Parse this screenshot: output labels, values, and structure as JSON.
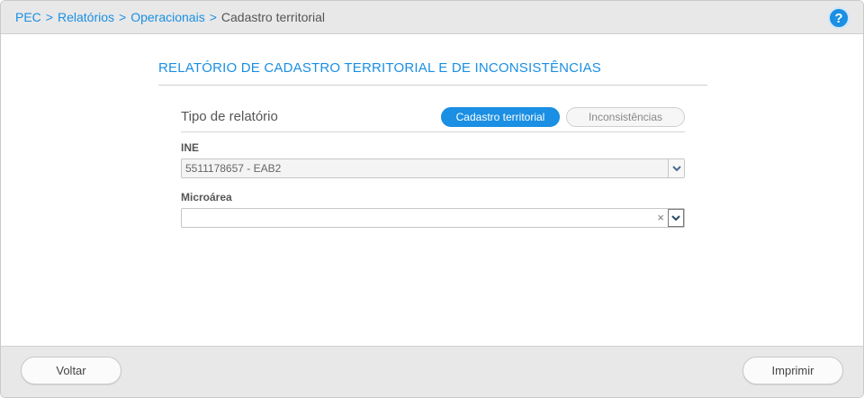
{
  "breadcrumb": {
    "items": [
      "PEC",
      "Relatórios",
      "Operacionais"
    ],
    "separator": ">",
    "current": "Cadastro territorial"
  },
  "help": {
    "label": "?",
    "icon": "help-circle-icon"
  },
  "report": {
    "title": "RELATÓRIO DE CADASTRO TERRITORIAL E DE INCONSISTÊNCIAS"
  },
  "form": {
    "type_label": "Tipo de relatório",
    "type_options": [
      "Cadastro territorial",
      "Inconsistências"
    ],
    "type_selected": "Cadastro territorial",
    "ine_label": "INE",
    "ine_value": "5511178657 - EAB2",
    "microarea_label": "Microárea",
    "microarea_value": "",
    "clear_symbol": "×"
  },
  "footer": {
    "back_label": "Voltar",
    "print_label": "Imprimir"
  },
  "colors": {
    "accent": "#1a8fe3",
    "bar_bg": "#e8e8e8"
  }
}
